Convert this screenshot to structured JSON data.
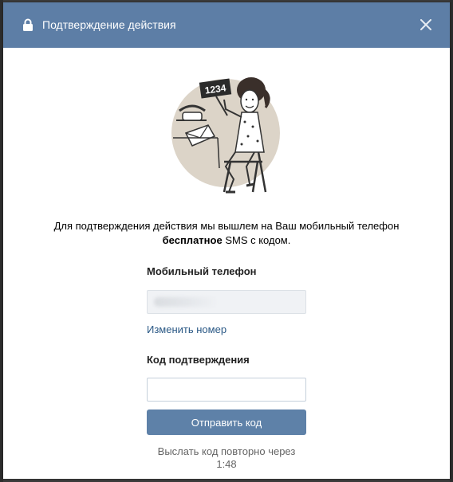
{
  "modal": {
    "title": "Подтверждение действия",
    "header_color": "#5d7ea6"
  },
  "illustration": {
    "sign_text": "1234",
    "icon": "woman-with-phone-icon"
  },
  "message": {
    "line1": "Для подтверждения действия мы вышлем на Ваш мобильный телефон",
    "bold_part": "бесплатное",
    "line2_rest": " SMS с кодом."
  },
  "form": {
    "phone_label": "Мобильный телефон",
    "phone_value": "",
    "change_number_link": "Изменить номер",
    "code_label": "Код подтверждения",
    "code_value": "",
    "send_button": "Отправить код",
    "resend_text": "Выслать код повторно через 1:48"
  },
  "colors": {
    "accent": "#5e81a8",
    "link": "#2a5885"
  }
}
